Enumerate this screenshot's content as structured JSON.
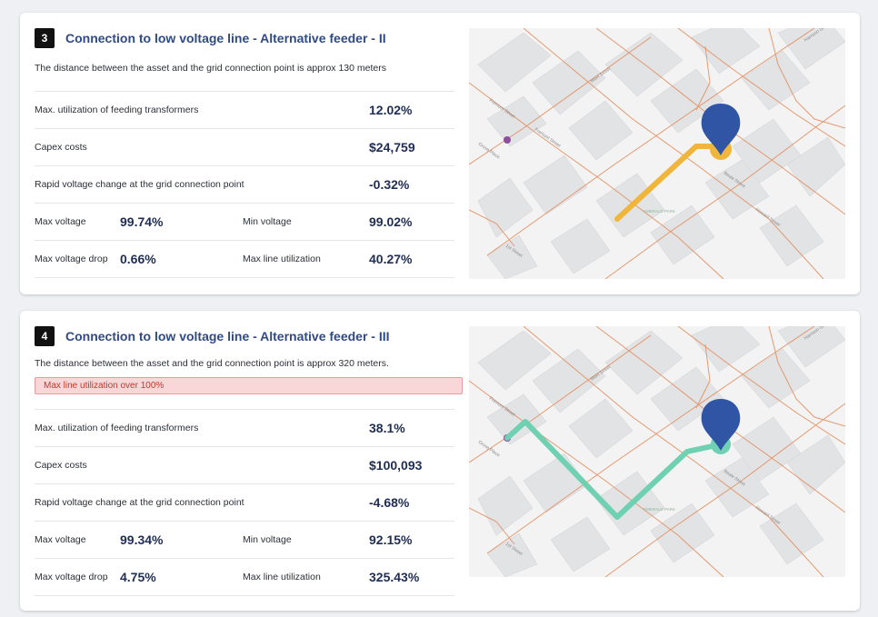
{
  "cards": [
    {
      "number": "3",
      "title": "Connection to low voltage line - Alternative feeder - II",
      "description": "The distance between the asset and the grid connection point is approx 130 meters",
      "alert": "",
      "metrics": {
        "transformers_label": "Max. utilization of feeding transformers",
        "transformers_value": "12.02%",
        "capex_label": "Capex costs",
        "capex_value": "$24,759",
        "rapid_label": "Rapid voltage change at the grid connection point",
        "rapid_value": "-0.32%",
        "max_voltage_label": "Max voltage",
        "max_voltage_value": "99.74%",
        "min_voltage_label": "Min voltage",
        "min_voltage_value": "99.02%",
        "max_drop_label": "Max voltage drop",
        "max_drop_value": "0.66%",
        "max_line_label": "Max line utilization",
        "max_line_value": "40.27%"
      },
      "map": {
        "route_color": "#f0b63c",
        "pin_color": "#2f55a4",
        "streets": [
          "Fremont Street",
          "Fremont Street",
          "Grove Place",
          "1st Street",
          "Beale Street",
          "Howard Street",
          "Harrison St",
          "Main Street",
          "EMERALD PARK"
        ]
      }
    },
    {
      "number": "4",
      "title": "Connection to low voltage line - Alternative feeder - III",
      "description": "The distance between the asset and the grid connection point is approx 320 meters.",
      "alert": "Max line utilization over 100%",
      "metrics": {
        "transformers_label": "Max. utilization of feeding transformers",
        "transformers_value": "38.1%",
        "capex_label": "Capex costs",
        "capex_value": "$100,093",
        "rapid_label": "Rapid voltage change at the grid connection point",
        "rapid_value": "-4.68%",
        "max_voltage_label": "Max voltage",
        "max_voltage_value": "99.34%",
        "min_voltage_label": "Min voltage",
        "min_voltage_value": "92.15%",
        "max_drop_label": "Max voltage drop",
        "max_drop_value": "4.75%",
        "max_line_label": "Max line utilization",
        "max_line_value": "325.43%"
      },
      "map": {
        "route_color": "#6fd0b2",
        "pin_color": "#2f55a4",
        "streets": [
          "Fremont Street",
          "Grove Place",
          "1st Street",
          "Beale Street",
          "Howard Street",
          "Harrison St",
          "Main Street",
          "EMERALD PARK"
        ]
      }
    }
  ]
}
